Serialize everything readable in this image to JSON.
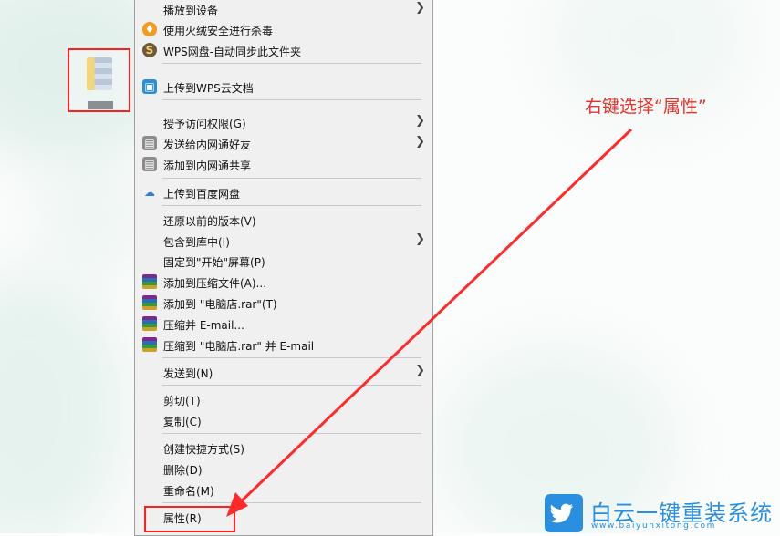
{
  "menu": {
    "items": [
      {
        "label": "播放到设备",
        "icon": "",
        "submenu": true
      },
      {
        "label": "使用火绒安全进行杀毒",
        "icon": "huorong-fire-icon",
        "submenu": false
      },
      {
        "label": "WPS网盘-自动同步此文件夹",
        "icon": "wps-cloud-icon",
        "submenu": false
      },
      {
        "label": "上传到WPS云文档",
        "icon": "wps-cube-icon",
        "submenu": false
      },
      {
        "label": "授予访问权限(G)",
        "icon": "",
        "submenu": true
      },
      {
        "label": "发送给内网通好友",
        "icon": "neiwangtong-icon",
        "submenu": true
      },
      {
        "label": "添加到内网通共享",
        "icon": "neiwangtong-icon",
        "submenu": false
      },
      {
        "label": "上传到百度网盘",
        "icon": "baidu-cloud-icon",
        "submenu": false
      },
      {
        "label": "还原以前的版本(V)",
        "icon": "",
        "submenu": false
      },
      {
        "label": "包含到库中(I)",
        "icon": "",
        "submenu": true
      },
      {
        "label": "固定到\"开始\"屏幕(P)",
        "icon": "",
        "submenu": false
      },
      {
        "label": "添加到压缩文件(A)...",
        "icon": "winrar-icon",
        "submenu": false
      },
      {
        "label": "添加到 \"电脑店.rar\"(T)",
        "icon": "winrar-icon",
        "submenu": false
      },
      {
        "label": "压缩并 E-mail...",
        "icon": "winrar-icon",
        "submenu": false
      },
      {
        "label": "压缩到 \"电脑店.rar\" 并 E-mail",
        "icon": "winrar-icon",
        "submenu": false
      },
      {
        "label": "发送到(N)",
        "icon": "",
        "submenu": true
      },
      {
        "label": "剪切(T)",
        "icon": "",
        "submenu": false
      },
      {
        "label": "复制(C)",
        "icon": "",
        "submenu": false
      },
      {
        "label": "创建快捷方式(S)",
        "icon": "",
        "submenu": false
      },
      {
        "label": "删除(D)",
        "icon": "",
        "submenu": false
      },
      {
        "label": "重命名(M)",
        "icon": "",
        "submenu": false
      },
      {
        "label": "属性(R)",
        "icon": "",
        "submenu": false
      }
    ]
  },
  "annotation": {
    "text": "右键选择“属性”"
  },
  "watermark": {
    "name": "白云一键重装系统",
    "url": "www.baiyunxitong.com"
  },
  "colors": {
    "annotation": "#e8322b",
    "highlight": "#ff1f1f",
    "logo": "#2a8fe0",
    "menu_bg": "#f0f0f0"
  }
}
